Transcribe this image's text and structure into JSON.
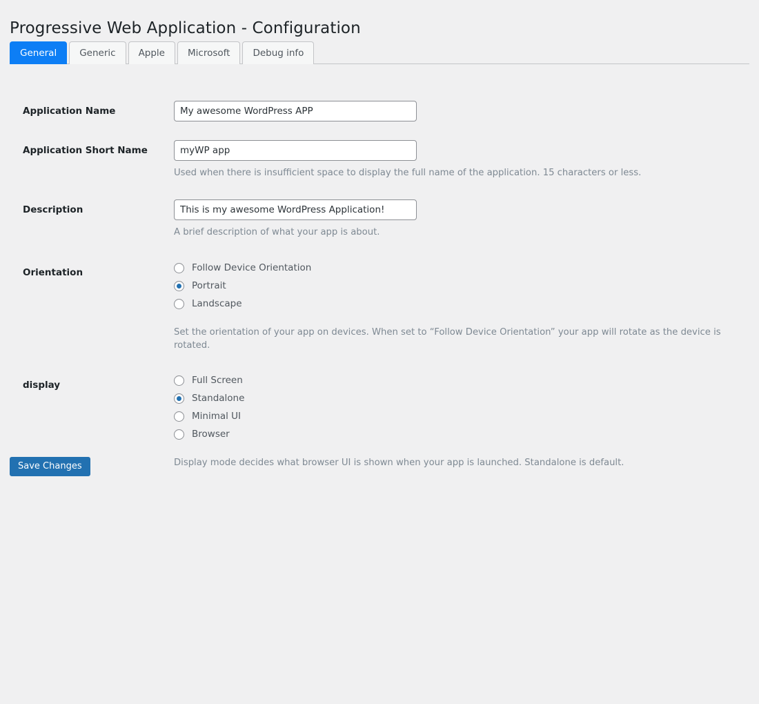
{
  "page": {
    "title": "Progressive Web Application - Configuration"
  },
  "tabs": [
    {
      "label": "General",
      "active": true
    },
    {
      "label": "Generic",
      "active": false
    },
    {
      "label": "Apple",
      "active": false
    },
    {
      "label": "Microsoft",
      "active": false
    },
    {
      "label": "Debug info",
      "active": false
    }
  ],
  "fields": {
    "app_name": {
      "label": "Application Name",
      "value": "My awesome WordPress APP",
      "help": ""
    },
    "app_short_name": {
      "label": "Application Short Name",
      "value": "myWP app",
      "help": "Used when there is insufficient space to display the full name of the application. 15 characters or less."
    },
    "description": {
      "label": "Description",
      "value": "This is my awesome WordPress Application!",
      "help": "A brief description of what your app is about."
    },
    "orientation": {
      "label": "Orientation",
      "help": "Set the orientation of your app on devices. When set to “Follow Device Orientation” your app will rotate as the device is rotated.",
      "selected": "Portrait",
      "options": [
        {
          "label": "Follow Device Orientation",
          "checked": false
        },
        {
          "label": "Portrait",
          "checked": true
        },
        {
          "label": "Landscape",
          "checked": false
        }
      ]
    },
    "display": {
      "label": "display",
      "help": "Display mode decides what browser UI is shown when your app is launched. Standalone is default.",
      "selected": "Standalone",
      "options": [
        {
          "label": "Full Screen",
          "checked": false
        },
        {
          "label": "Standalone",
          "checked": true
        },
        {
          "label": "Minimal UI",
          "checked": false
        },
        {
          "label": "Browser",
          "checked": false
        }
      ]
    }
  },
  "actions": {
    "save_label": "Save Changes"
  },
  "colors": {
    "page_background": "#f0f0f1",
    "active_tab": "#0d7ef5",
    "primary_button": "#2271b1",
    "radio_selected": "#2271b1",
    "label_text": "#1d2327",
    "help_text": "#7e8993"
  }
}
